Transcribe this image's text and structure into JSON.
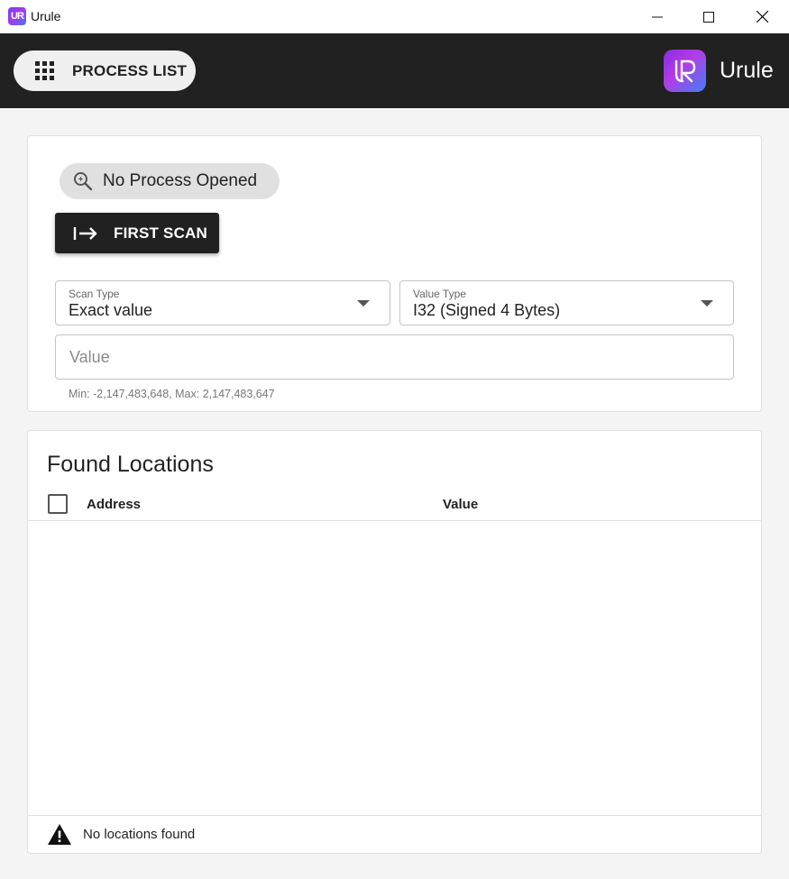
{
  "window": {
    "title": "Urule",
    "app_icon_text": "UR",
    "controls": {
      "minimize": "minimize-icon",
      "maximize": "maximize-icon",
      "close": "close-icon"
    }
  },
  "appbar": {
    "process_list_label": "PROCESS LIST",
    "process_list_icon": "apps-grid-icon",
    "brand_name": "Urule",
    "colors": {
      "background": "#212121",
      "brand_gradient": [
        "#8a2be2",
        "#3b82f6"
      ]
    }
  },
  "scan_panel": {
    "process_status": "No Process Opened",
    "process_status_icon": "search-icon",
    "first_scan_label": "FIRST SCAN",
    "first_scan_icon": "arrow-right-to-line-icon",
    "scan_type": {
      "label": "Scan Type",
      "value": "Exact value"
    },
    "value_type": {
      "label": "Value Type",
      "value": "I32 (Signed 4 Bytes)"
    },
    "value_input": {
      "placeholder": "Value",
      "value": ""
    },
    "helper_text": "Min: -2,147,483,648, Max: 2,147,483,647"
  },
  "found_locations": {
    "title": "Found Locations",
    "columns": [
      "Address",
      "Value"
    ],
    "rows": [],
    "status_text": "No locations found",
    "status_icon": "warning-icon"
  }
}
